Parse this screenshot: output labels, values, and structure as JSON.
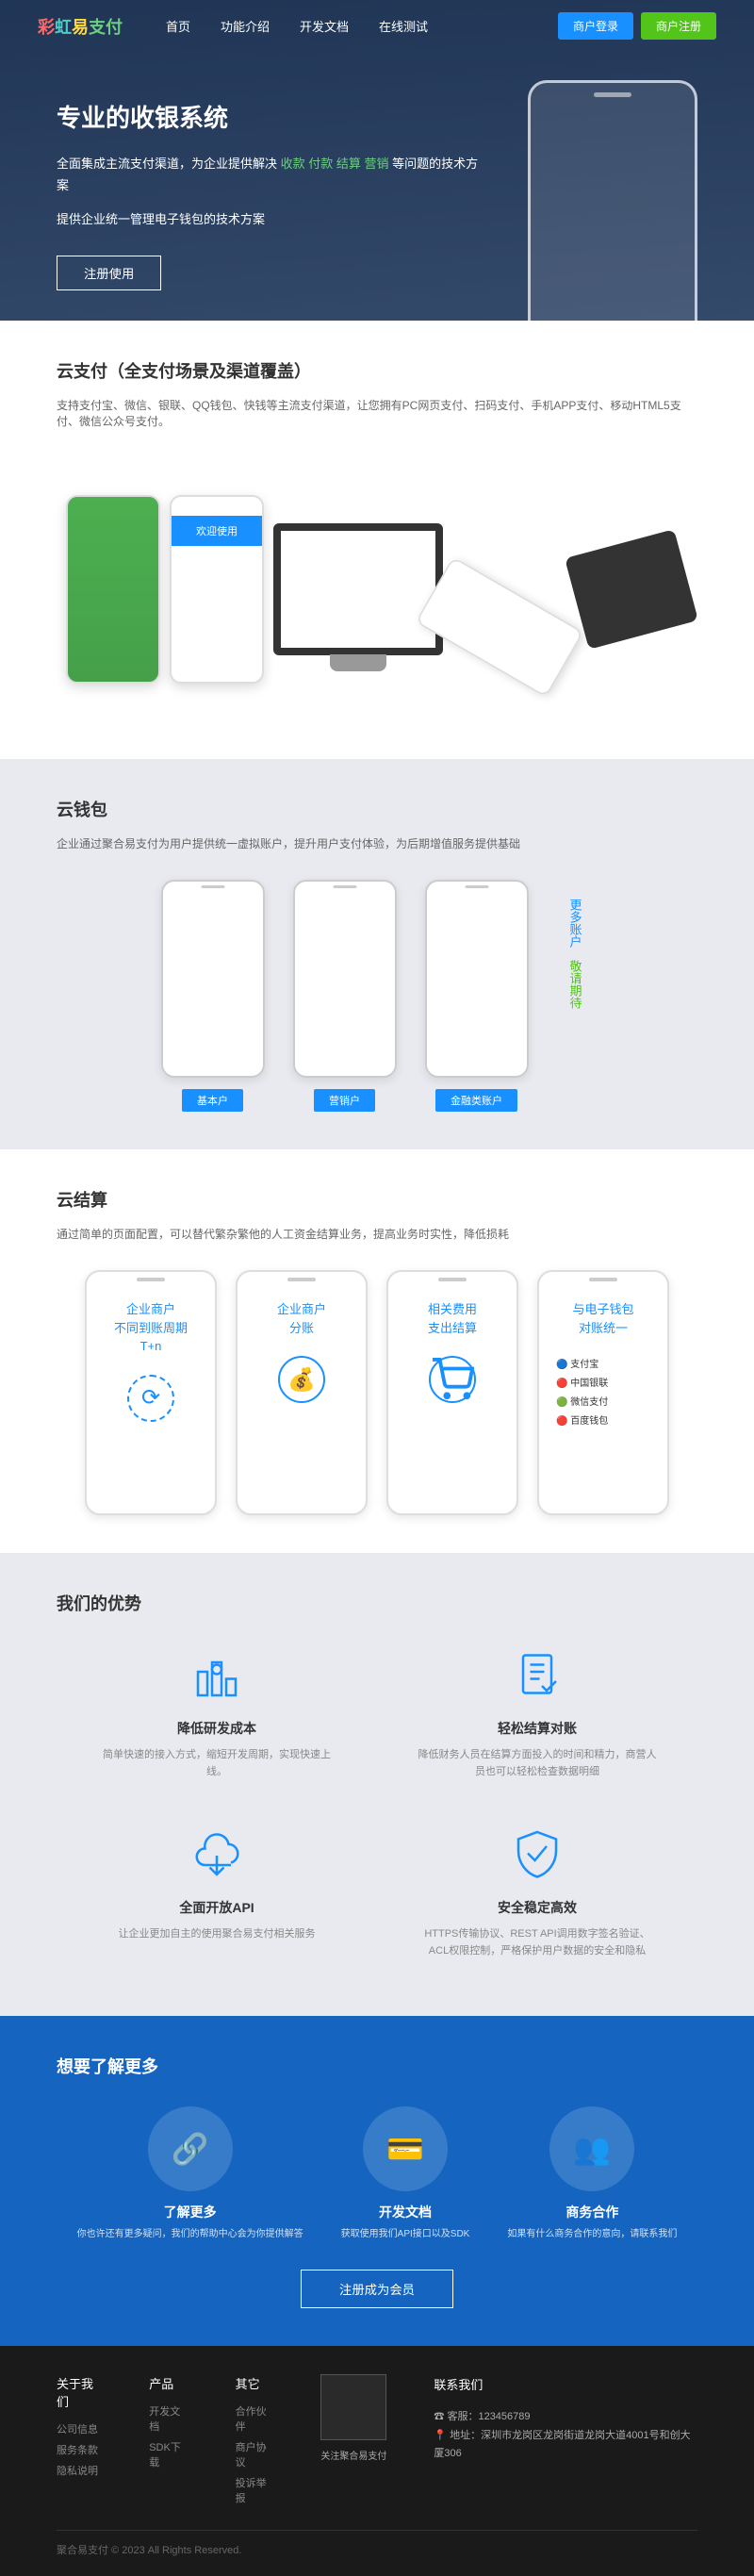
{
  "nav": {
    "logo": "彩虹易支付",
    "items": [
      "首页",
      "功能介绍",
      "开发文档",
      "在线测试"
    ],
    "login": "商户登录",
    "register": "商户注册"
  },
  "hero": {
    "title": "专业的收银系统",
    "desc1_pre": "全面集成主流支付渠道，为企业提供解决 ",
    "desc1_hl": "收款 付款 结算 营销",
    "desc1_post": " 等问题的技术方案",
    "desc2": "提供企业统一管理电子钱包的技术方案",
    "btn": "注册使用"
  },
  "cloudpay": {
    "title": "云支付（全支付场景及渠道覆盖）",
    "desc": "支持支付宝、微信、银联、QQ钱包、快钱等主流支付渠道，让您拥有PC网页支付、扫码支付、手机APP支付、移动HTML5支付、微信公众号支付。"
  },
  "wallet": {
    "title": "云钱包",
    "desc": "企业通过聚合易支付为用户提供统一虚拟账户，提升用户支付体验，为后期增值服务提供基础",
    "items": [
      "基本户",
      "营销户",
      "金融类账户"
    ],
    "more1": "更多账户",
    "more2": "敬请期待"
  },
  "settle": {
    "title": "云结算",
    "desc": "通过简单的页面配置，可以替代繁杂繁他的人工资金结算业务，提高业务时实性，降低损耗",
    "items": [
      {
        "line1": "企业商户",
        "line2": "不同到账周期",
        "line3": "T+n"
      },
      {
        "line1": "企业商户",
        "line2": "分账",
        "line3": ""
      },
      {
        "line1": "相关费用",
        "line2": "支出结算",
        "line3": ""
      },
      {
        "line1": "与电子钱包",
        "line2": "对账统一",
        "line3": ""
      }
    ]
  },
  "adv": {
    "title": "我们的优势",
    "items": [
      {
        "title": "降低研发成本",
        "desc": "简单快速的接入方式，缩短开发周期，实现快速上线。"
      },
      {
        "title": "轻松结算对账",
        "desc": "降低财务人员在结算方面投入的时间和精力，商营人员也可以轻松检查数据明细"
      },
      {
        "title": "全面开放API",
        "desc": "让企业更加自主的使用聚合易支付相关服务"
      },
      {
        "title": "安全稳定高效",
        "desc": "HTTPS传输协议、REST API调用数字签名验证、ACL权限控制，严格保护用户数据的安全和隐私"
      }
    ]
  },
  "more": {
    "title": "想要了解更多",
    "items": [
      {
        "title": "了解更多",
        "desc": "你也许还有更多疑问，我们的帮助中心会为你提供解答"
      },
      {
        "title": "开发文档",
        "desc": "获取使用我们API接口以及SDK"
      },
      {
        "title": "商务合作",
        "desc": "如果有什么商务合作的意向，请联系我们"
      }
    ],
    "btn": "注册成为会员"
  },
  "footer": {
    "cols": [
      {
        "title": "关于我们",
        "links": [
          "公司信息",
          "服务条款",
          "隐私说明"
        ]
      },
      {
        "title": "产品",
        "links": [
          "开发文档",
          "SDK下载"
        ]
      },
      {
        "title": "其它",
        "links": [
          "合作伙伴",
          "商户协议",
          "投诉举报"
        ]
      }
    ],
    "qr_label": "关注聚合易支付",
    "contact_title": "联系我们",
    "phone_label": "客服：",
    "phone": "123456789",
    "addr_label": "地址：",
    "addr": "深圳市龙岗区龙岗街道龙岗大道4001号和创大厦306",
    "copyright": "聚合易支付 © 2023 All Rights Reserved."
  }
}
